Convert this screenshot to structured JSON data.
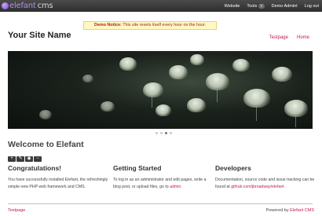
{
  "admin_bar": {
    "logo_text": "elefant",
    "logo_suffix": "cms",
    "links": [
      "Website",
      "Tools",
      "Demo Admin",
      "Log out"
    ],
    "tools_badge": "V",
    "user_suffix": "I"
  },
  "notice": {
    "label": "Demo Notice:",
    "text": "This site resets itself every hour on the hour."
  },
  "site": {
    "name": "Your Site Name",
    "nav": [
      "Testpage",
      "Home"
    ]
  },
  "slider": {
    "dot_count": 4,
    "active_index": 2,
    "image_icon": "jellyfish-photo"
  },
  "page": {
    "title": "Welcome to Elefant",
    "toolbar_icons": [
      "plus-icon",
      "pencil-icon",
      "eye-icon",
      "minus-icon"
    ],
    "toolbar_glyphs": [
      "+",
      "✎",
      "◉",
      "−"
    ]
  },
  "columns": [
    {
      "title": "Congratulations!",
      "text": "You have successfully installed Elefant, the refreshingly simple new PHP web framework and CMS."
    },
    {
      "title": "Getting Started",
      "text": "To log in as an administrator and edit pages, write a blog post, or upload files, go to",
      "link": "admin",
      "after": "."
    },
    {
      "title": "Developers",
      "text": "Documentation, source code and issue tracking can be found at",
      "link": "github.com/jbroadway/elefant"
    }
  ],
  "footer": {
    "left": "Testpage",
    "powered_by": "Powered by",
    "powered_link": "Elefant CMS"
  },
  "colors": {
    "accent": "#c2185b",
    "admin_bar": "#3a3a3a",
    "notice_bg": "#fff8c4"
  }
}
